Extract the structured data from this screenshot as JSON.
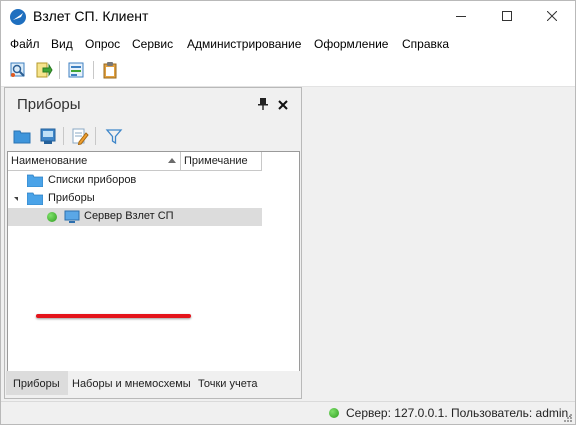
{
  "window": {
    "title": "Взлет СП. Клиент"
  },
  "menu": [
    "Файл",
    "Вид",
    "Опрос",
    "Сервис",
    "Администрирование",
    "Оформление",
    "Справка"
  ],
  "toolbar": {
    "icons": [
      "find-device-icon",
      "export-icon",
      "report-icon",
      "clipboard-icon"
    ]
  },
  "panel": {
    "title": "Приборы",
    "tools": [
      "open-folder-icon",
      "device-icon",
      "edit-icon",
      "filter-icon"
    ],
    "columns": [
      "Наименование",
      "Примечание"
    ],
    "tree": [
      {
        "label": "Списки приборов",
        "icon": "folder-icon",
        "level": 1,
        "expanded": false
      },
      {
        "label": "Приборы",
        "icon": "folder-icon",
        "level": 1,
        "expanded": true
      },
      {
        "label": "Сервер Взлет СП",
        "icon": "computer-icon",
        "level": 2,
        "status": "online",
        "selected": true
      }
    ],
    "tabs": [
      "Приборы",
      "Наборы и мнемосхемы",
      "Точки учета"
    ],
    "active_tab": "Приборы"
  },
  "status": {
    "text": "Сервер: 127.0.0.1. Пользователь: admin.",
    "indicator": "online"
  },
  "colors": {
    "accent": "#1f6fbf",
    "folder": "#4aa3e8",
    "online": "#3aad2a",
    "annotation": "#e4141b",
    "selection": "#dcdcdc"
  }
}
